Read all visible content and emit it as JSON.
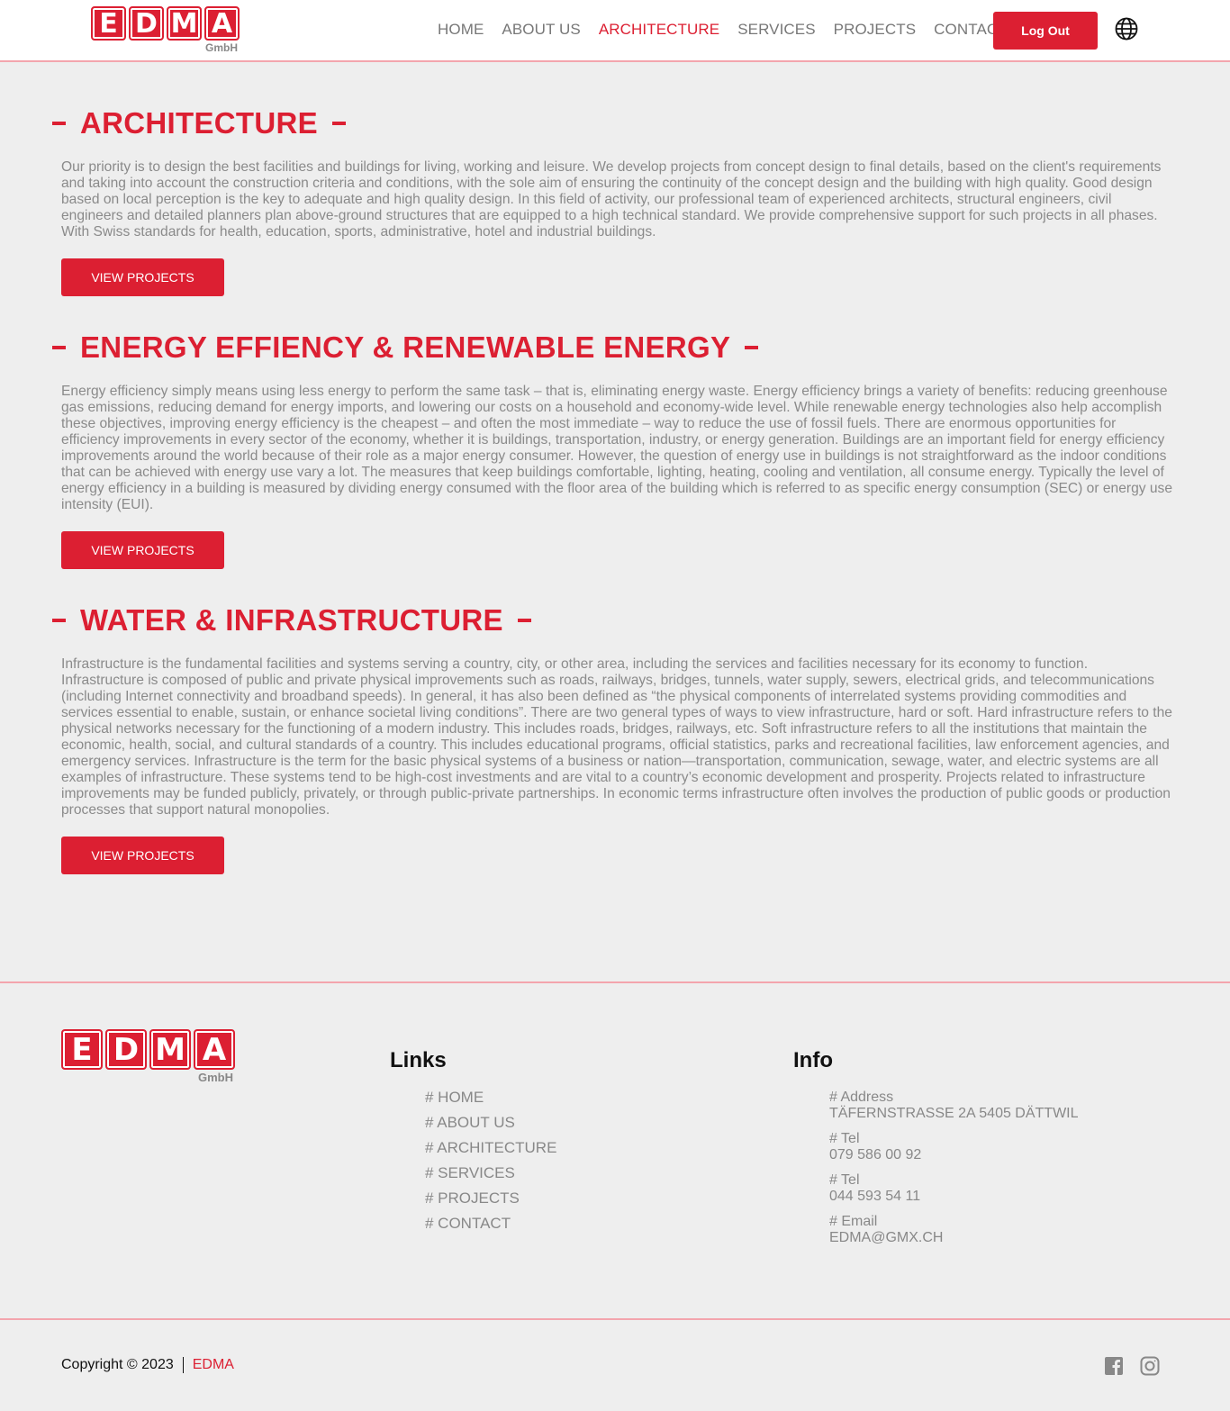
{
  "header": {
    "logo_text": "EDMA",
    "logo_sub": "GmbH",
    "nav": [
      "HOME",
      "ABOUT US",
      "ARCHITECTURE",
      "SERVICES",
      "PROJECTS",
      "CONTACT"
    ],
    "active_nav": "ARCHITECTURE",
    "logout_label": "Log Out",
    "language_icon": "globe-icon"
  },
  "sections": [
    {
      "title": "ARCHITECTURE",
      "text": "Our priority is to design the best facilities and buildings for living, working and leisure. We develop projects from concept design to final details, based on the client's requirements and taking into account the construction criteria and conditions, with the sole aim of ensuring the continuity of the concept design and the building with high quality. Good design based on local perception is the key to adequate and high quality design. In this field of activity, our professional team of experienced architects, structural engineers, civil engineers and detailed planners plan above-ground structures that are equipped to a high technical standard. We provide comprehensive support for such projects in all phases. With Swiss standards for health, education, sports, administrative, hotel and industrial buildings.",
      "button": "VIEW PROJECTS"
    },
    {
      "title": "ENERGY EFFIENCY & RENEWABLE ENERGY",
      "text": "Energy efficiency simply means using less energy to perform the same task – that is, eliminating energy waste. Energy efficiency brings a variety of benefits: reducing greenhouse gas emissions, reducing demand for energy imports, and lowering our costs on a household and economy-wide level. While renewable energy technologies also help accomplish these objectives, improving energy efficiency is the cheapest – and often the most immediate – way to reduce the use of fossil fuels. There are enormous opportunities for efficiency improvements in every sector of the economy, whether it is buildings, transportation, industry, or energy generation. Buildings are an important field for energy efficiency improvements around the world because of their role as a major energy consumer. However, the question of energy use in buildings is not straightforward as the indoor conditions that can be achieved with energy use vary a lot. The measures that keep buildings comfortable, lighting, heating, cooling and ventilation, all consume energy. Typically the level of energy efficiency in a building is measured by dividing energy consumed with the floor area of the building which is referred to as specific energy consumption (SEC) or energy use intensity (EUI).",
      "button": "VIEW PROJECTS"
    },
    {
      "title": "WATER & INFRASTRUCTURE",
      "text": "Infrastructure is the fundamental facilities and systems serving a country, city, or other area, including the services and facilities necessary for its economy to function. Infrastructure is composed of public and private physical improvements such as roads, railways, bridges, tunnels, water supply, sewers, electrical grids, and telecommunications (including Internet connectivity and broadband speeds). In general, it has also been defined as “the physical components of interrelated systems providing commodities and services essential to enable, sustain, or enhance societal living conditions”. There are two general types of ways to view infrastructure, hard or soft. Hard infrastructure refers to the physical networks necessary for the functioning of a modern industry. This includes roads, bridges, railways, etc. Soft infrastructure refers to all the institutions that maintain the economic, health, social, and cultural standards of a country. This includes educational programs, official statistics, parks and recreational facilities, law enforcement agencies, and emergency services. Infrastructure is the term for the basic physical systems of a business or nation—transportation, communication, sewage, water, and electric systems are all examples of infrastructure. These systems tend to be high-cost investments and are vital to a country’s economic development and prosperity. Projects related to infrastructure improvements may be funded publicly, privately, or through public-private partnerships. In economic terms infrastructure often involves the production of public goods or production processes that support natural monopolies.",
      "button": "VIEW PROJECTS"
    }
  ],
  "footer": {
    "logo_text": "EDMA",
    "logo_sub": "GmbH",
    "links_heading": "Links",
    "links": [
      "# HOME",
      "# ABOUT US",
      "# ARCHITECTURE",
      "# SERVICES",
      "# PROJECTS",
      "# CONTACT"
    ],
    "info_heading": "Info",
    "info": [
      {
        "label": "# Address",
        "value": "TÄFERNSTRASSE 2A 5405 DÄTTWIL"
      },
      {
        "label": "# Tel",
        "value": "079 586 00 92"
      },
      {
        "label": "# Tel",
        "value": "044 593 54 11"
      },
      {
        "label": "# Email",
        "value": "EDMA@GMX.CH"
      }
    ],
    "copyright": "Copyright © 2023",
    "brand": "EDMA",
    "social": [
      "facebook-icon",
      "instagram-icon"
    ]
  },
  "colors": {
    "accent": "#dc1f32",
    "background": "#eeeeee",
    "divider": "#f3a5ad",
    "text_muted": "#888888"
  }
}
